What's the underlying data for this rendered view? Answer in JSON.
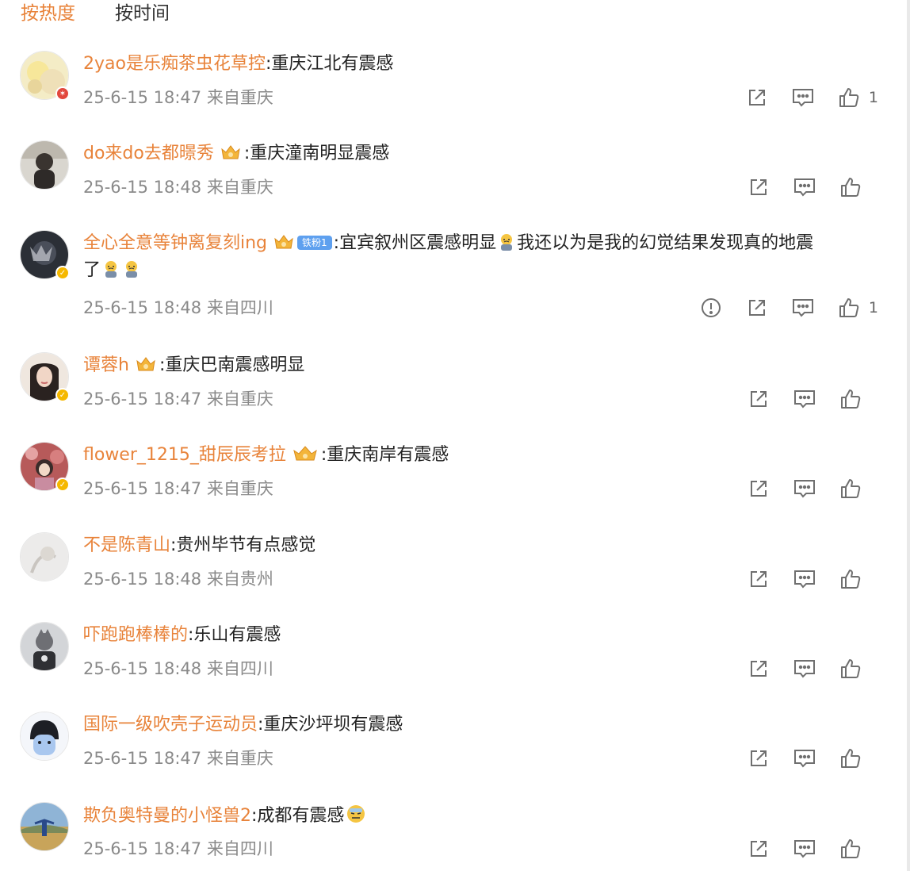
{
  "tabs": {
    "hot": "按热度",
    "time": "按时间"
  },
  "comments": [
    {
      "user": "2yao是乐痴茶虫花草控",
      "text": ":重庆江北有震感",
      "meta": "25-6-15 18:47 来自重庆",
      "likes": "1"
    },
    {
      "user": "do来do去都暻秀",
      "text": ":重庆潼南明显震感",
      "meta": "25-6-15 18:48 来自重庆",
      "likes": ""
    },
    {
      "user": "全心全意等钟离复刻ing",
      "fan_badge": "铁粉1",
      "text": ":宜宾叙州区震感明显",
      "text2": "我还以为是我的幻觉结果发现真的地震",
      "text3": "了",
      "meta": "25-6-15 18:48 来自四川",
      "likes": "1"
    },
    {
      "user": "谭蓉h",
      "text": ":重庆巴南震感明显",
      "meta": "25-6-15 18:47 来自重庆",
      "likes": ""
    },
    {
      "user": "flower_1215_甜辰辰考拉",
      "text": ":重庆南岸有震感",
      "meta": "25-6-15 18:47 来自重庆",
      "likes": ""
    },
    {
      "user": "不是陈青山",
      "text": ":贵州毕节有点感觉",
      "meta": "25-6-15 18:48 来自贵州",
      "likes": ""
    },
    {
      "user": "吓跑跑棒棒的",
      "text": ":乐山有震感",
      "meta": "25-6-15 18:48 来自四川",
      "likes": ""
    },
    {
      "user": "国际一级吹壳子运动员",
      "text": ":重庆沙坪坝有震感",
      "meta": "25-6-15 18:47 来自重庆",
      "likes": ""
    },
    {
      "user": "欺负奥特曼的小怪兽2",
      "text": ":成都有震感",
      "meta": "25-6-15 18:47 来自四川",
      "likes": ""
    }
  ],
  "colors": {
    "accent": "#e8833a",
    "meta": "#8a8a8a",
    "icon": "#6f6f6f"
  },
  "icons": {
    "share": "share-icon",
    "comment": "comment-icon",
    "like": "thumbs-up-icon",
    "report": "report-icon"
  }
}
